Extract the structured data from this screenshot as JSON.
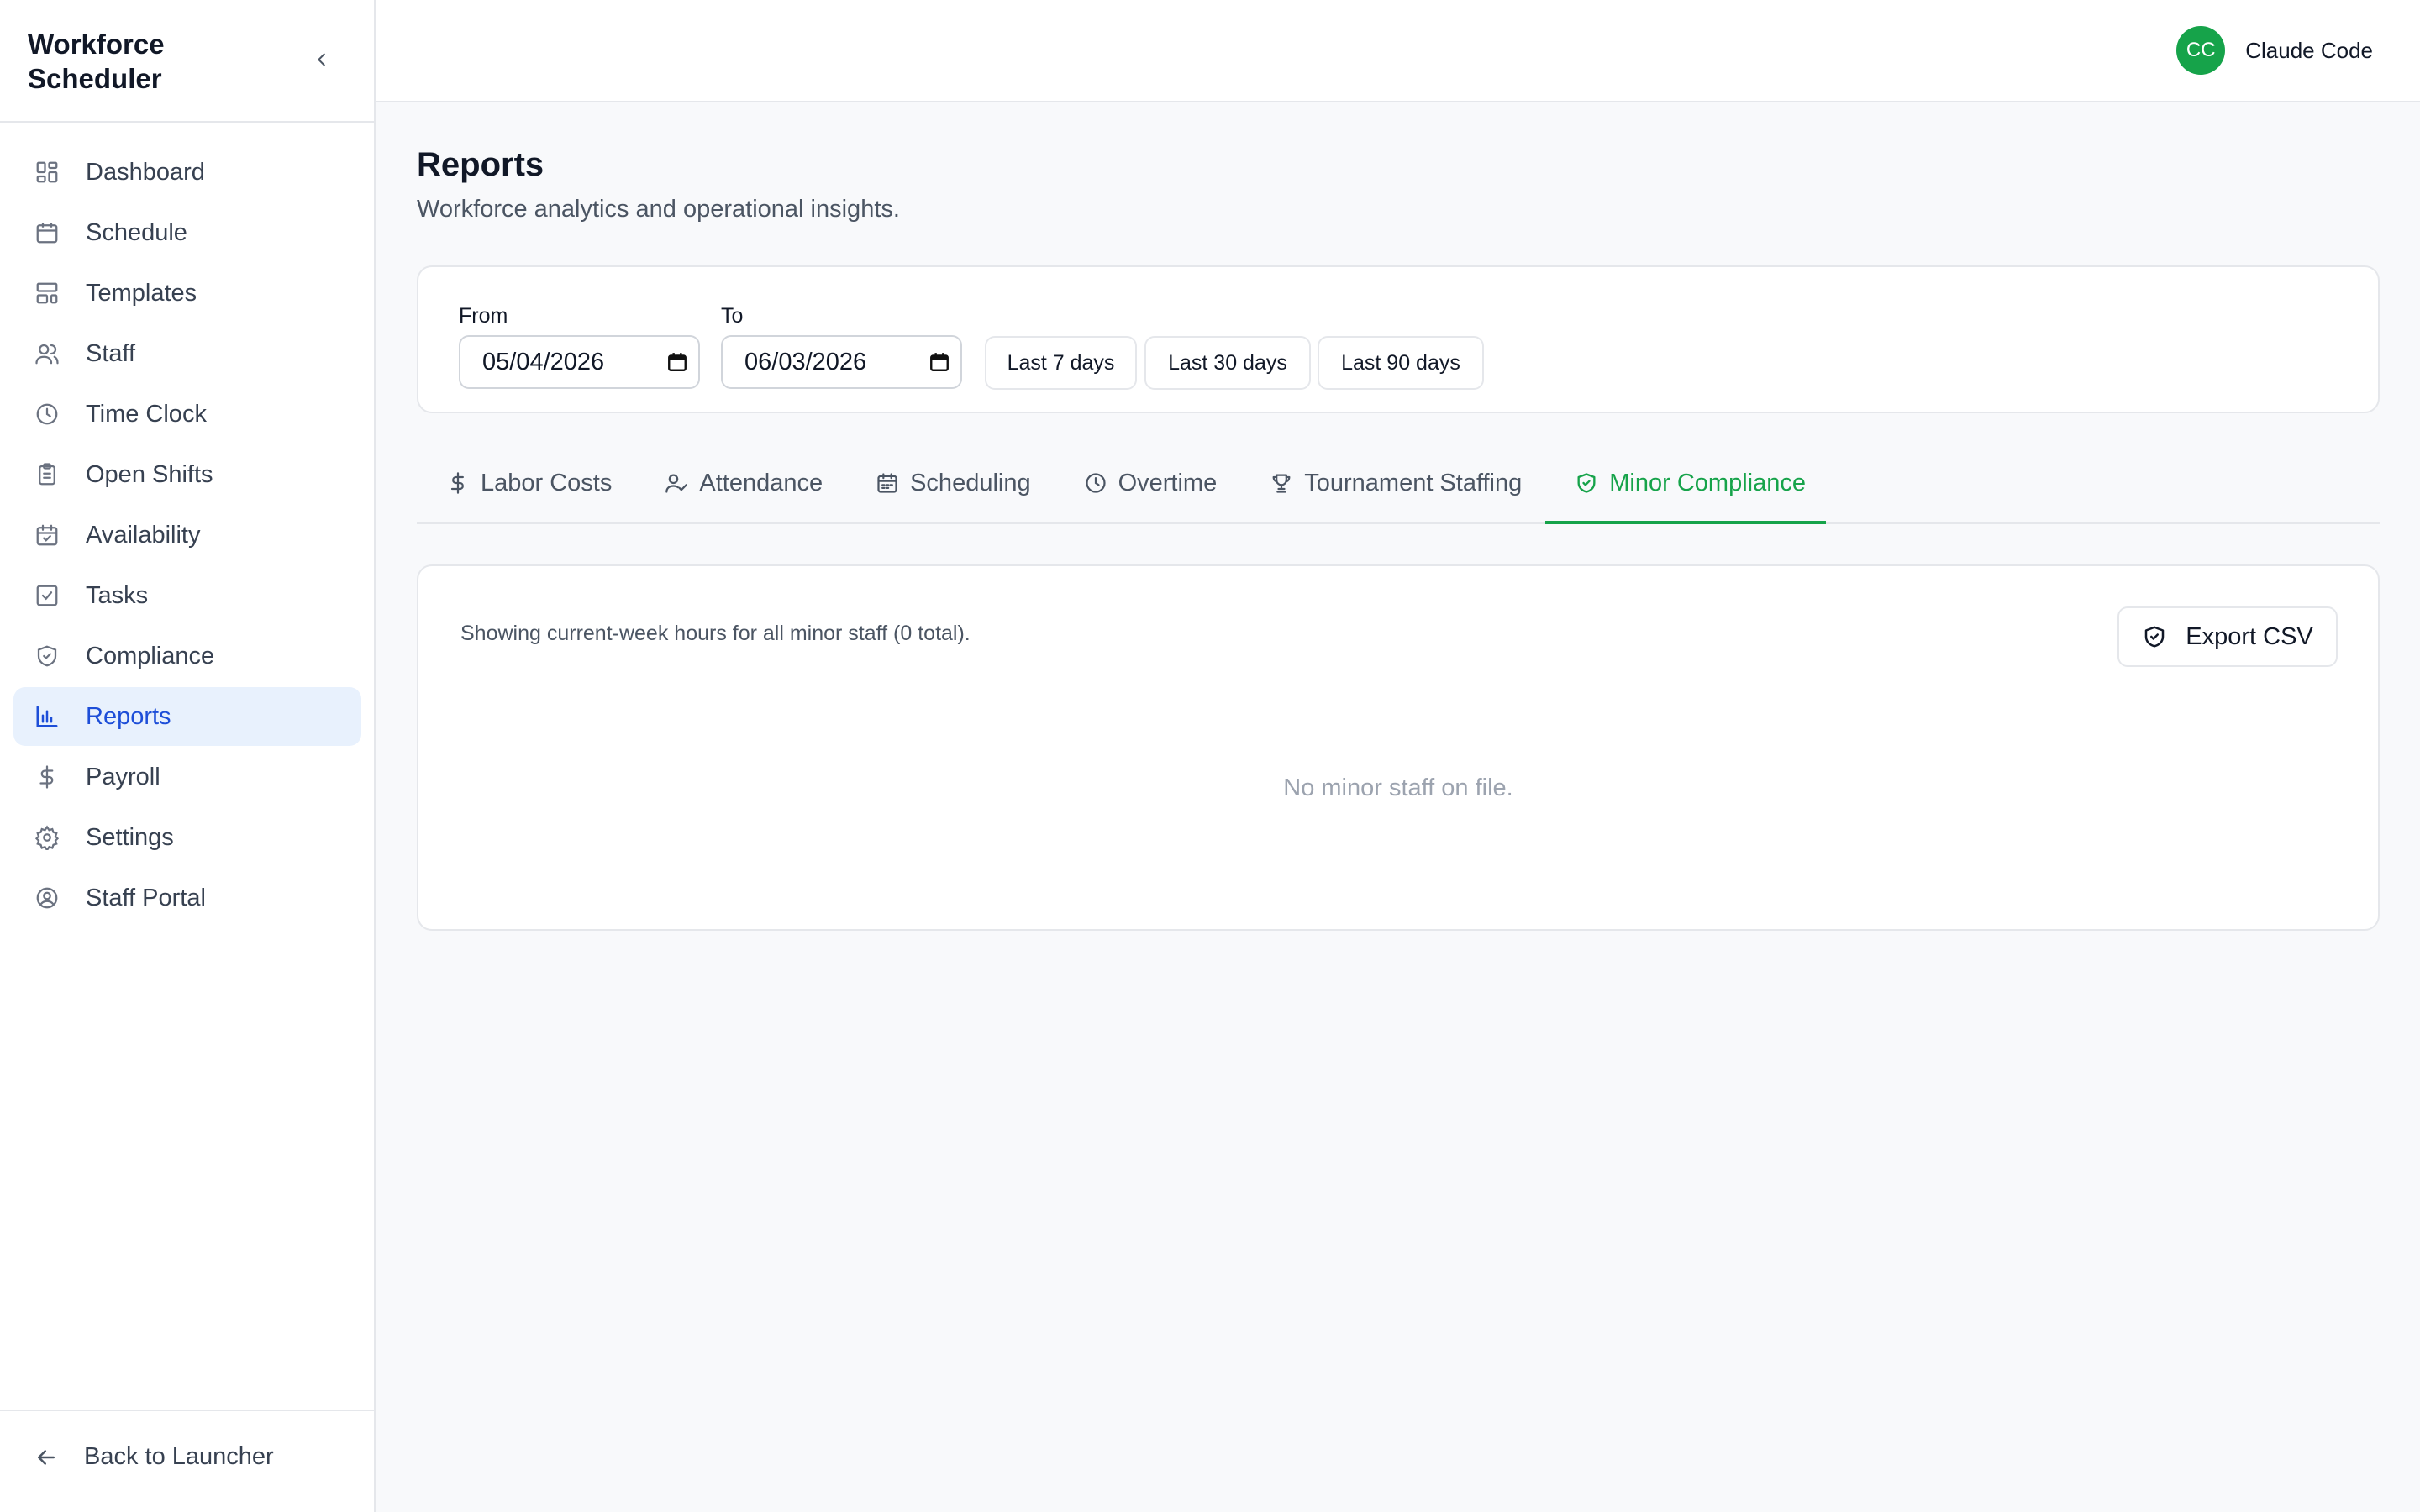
{
  "app": {
    "title": "Workforce Scheduler"
  },
  "sidebar": {
    "items": [
      {
        "label": "Dashboard",
        "icon": "dashboard-icon"
      },
      {
        "label": "Schedule",
        "icon": "calendar-icon"
      },
      {
        "label": "Templates",
        "icon": "template-icon"
      },
      {
        "label": "Staff",
        "icon": "users-icon"
      },
      {
        "label": "Time Clock",
        "icon": "clock-icon"
      },
      {
        "label": "Open Shifts",
        "icon": "clipboard-icon"
      },
      {
        "label": "Availability",
        "icon": "calendar-check-icon"
      },
      {
        "label": "Tasks",
        "icon": "checkbox-icon"
      },
      {
        "label": "Compliance",
        "icon": "shield-icon"
      },
      {
        "label": "Reports",
        "icon": "bar-chart-icon",
        "active": true
      },
      {
        "label": "Payroll",
        "icon": "dollar-icon"
      },
      {
        "label": "Settings",
        "icon": "gear-icon"
      },
      {
        "label": "Staff Portal",
        "icon": "user-circle-icon"
      }
    ],
    "back_label": "Back to Launcher"
  },
  "user": {
    "initials": "CC",
    "name": "Claude Code",
    "avatar_color": "#16a34a"
  },
  "page": {
    "title": "Reports",
    "subtitle": "Workforce analytics and operational insights."
  },
  "filters": {
    "from_label": "From",
    "from_value": "05/04/2026",
    "to_label": "To",
    "to_value": "06/03/2026",
    "ranges": [
      "Last 7 days",
      "Last 30 days",
      "Last 90 days"
    ]
  },
  "tabs": [
    {
      "label": "Labor Costs",
      "icon": "dollar-icon"
    },
    {
      "label": "Attendance",
      "icon": "user-check-icon"
    },
    {
      "label": "Scheduling",
      "icon": "calendar-icon"
    },
    {
      "label": "Overtime",
      "icon": "clock-icon"
    },
    {
      "label": "Tournament Staffing",
      "icon": "trophy-icon"
    },
    {
      "label": "Minor Compliance",
      "icon": "shield-check-icon",
      "active": true
    }
  ],
  "report": {
    "note": "Showing current-week hours for all minor staff (0 total).",
    "export_label": "Export CSV",
    "empty_message": "No minor staff on file."
  },
  "colors": {
    "accent": "#16a34a",
    "nav_active": "#1d4ed8",
    "nav_active_bg": "#e8f1fd"
  }
}
